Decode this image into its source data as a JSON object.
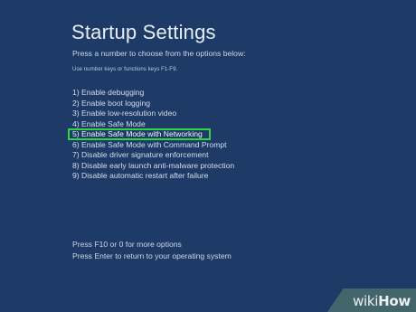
{
  "screen": {
    "title": "Startup Settings",
    "prompt": "Press a number to choose from the options below:",
    "hint": "Use number keys or functions keys F1-F9.",
    "options": [
      {
        "label": "1) Enable debugging"
      },
      {
        "label": "2) Enable boot logging"
      },
      {
        "label": "3) Enable low-resolution video"
      },
      {
        "label": "4) Enable Safe Mode"
      },
      {
        "label": "5) Enable Safe Mode with Networking",
        "selected": true
      },
      {
        "label": "6) Enable Safe Mode with Command Prompt"
      },
      {
        "label": "7) Disable driver signature enforcement"
      },
      {
        "label": "8) Disable early launch anti-malware protection"
      },
      {
        "label": "9) Disable automatic restart after failure"
      }
    ],
    "footer": {
      "more_options": "Press F10 or 0 for more options",
      "return_os": "Press Enter to return to your operating system"
    }
  },
  "watermark": {
    "part1": "wiki",
    "part2": "How"
  },
  "colors": {
    "background": "#1d3b66",
    "highlight": "#2fd63f"
  }
}
